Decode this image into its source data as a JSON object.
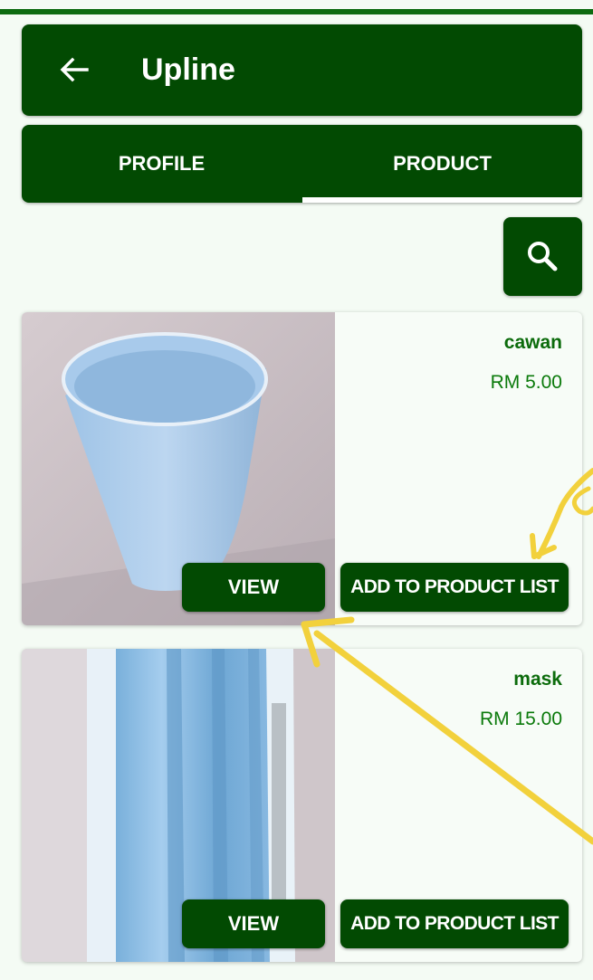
{
  "app_bar": {
    "title": "Upline",
    "back_icon": "arrow-left-icon"
  },
  "tabs": [
    {
      "label": "PROFILE",
      "selected": false
    },
    {
      "label": "PRODUCT",
      "selected": true
    }
  ],
  "search": {
    "icon": "search-icon"
  },
  "products": [
    {
      "name": "cawan",
      "price": "RM 5.00",
      "view_label": "VIEW",
      "add_label": "ADD TO PRODUCT LIST",
      "image": "blue plastic cup"
    },
    {
      "name": "mask",
      "price": "RM 15.00",
      "view_label": "VIEW",
      "add_label": "ADD TO PRODUCT LIST",
      "image": "blue face masks"
    }
  ],
  "colors": {
    "primary": "#024a02",
    "price_text": "#0b7a0b",
    "background": "#f4fbf4",
    "annotation": "#f2d13c"
  }
}
